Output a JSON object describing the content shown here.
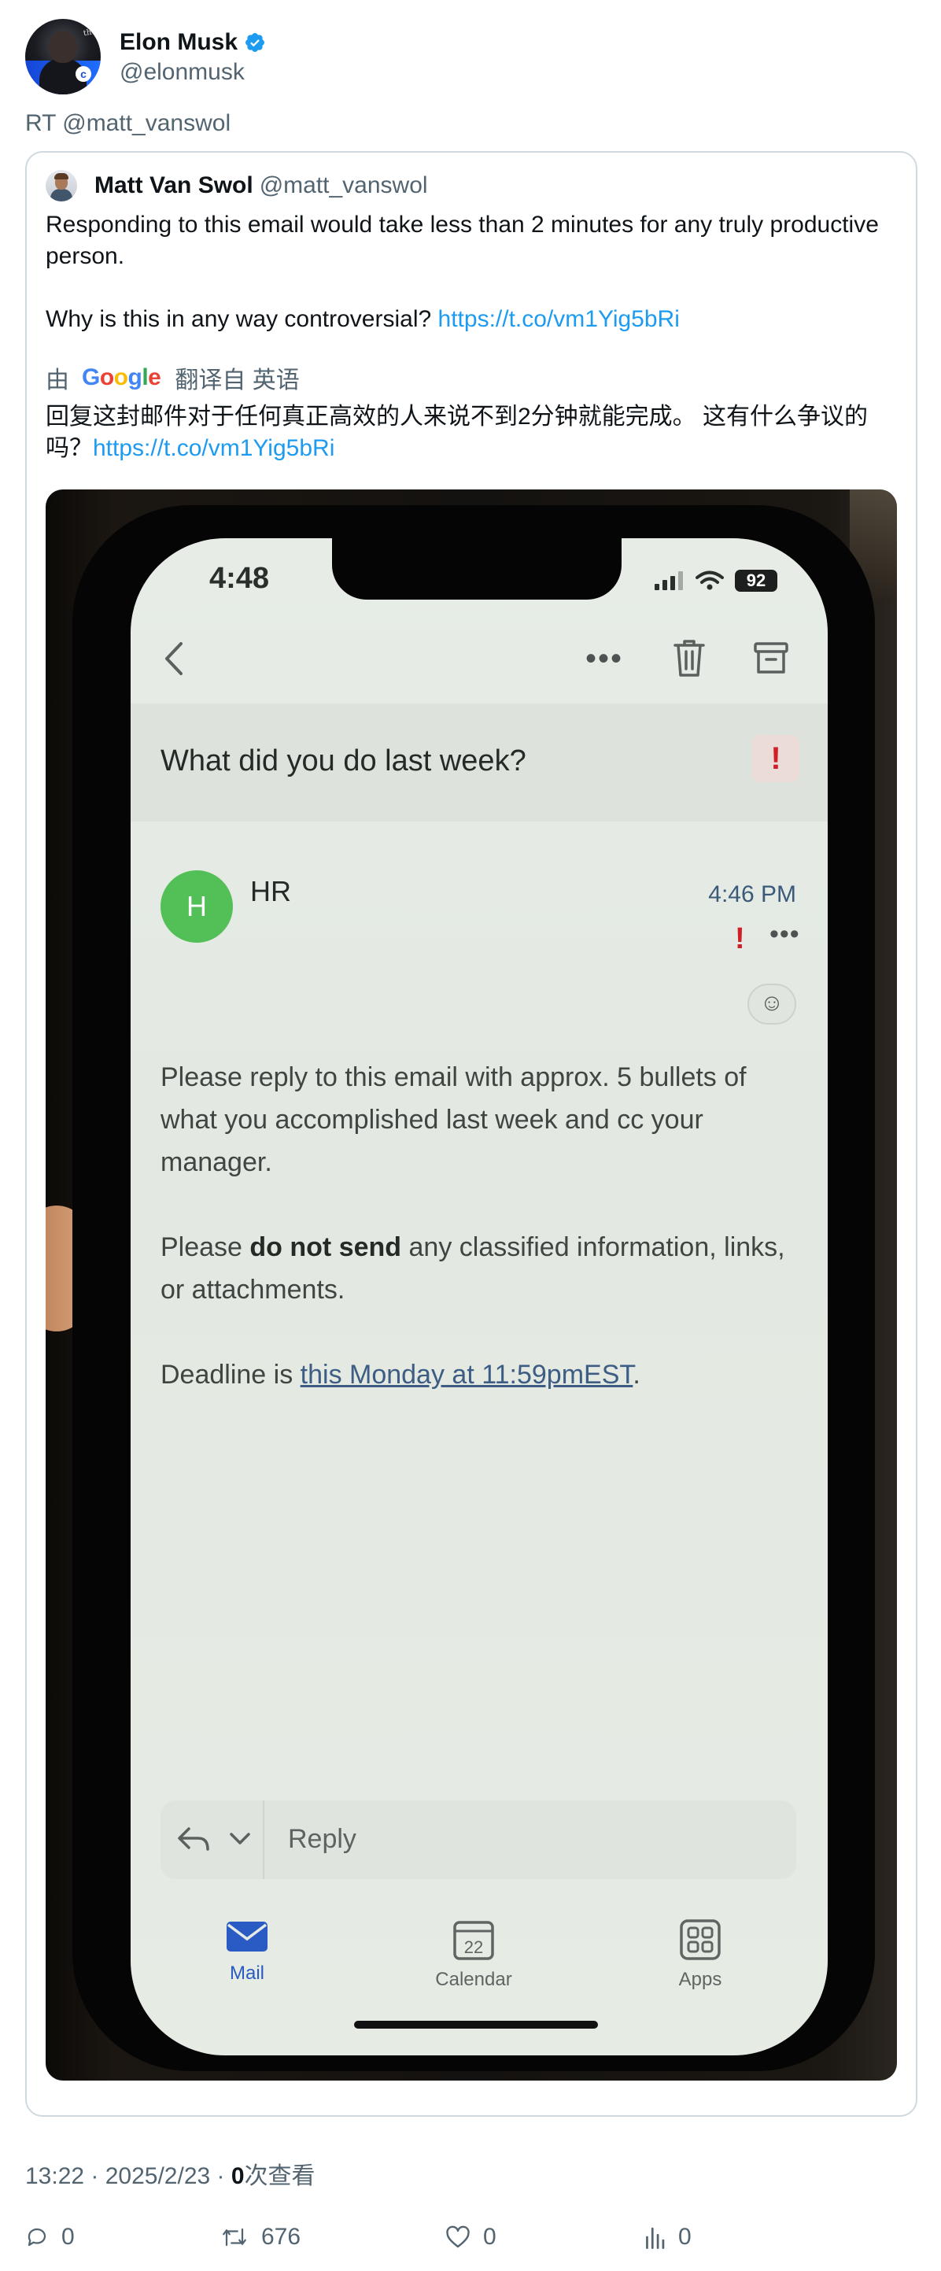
{
  "tweet": {
    "author_name": "Elon Musk",
    "author_handle": "@elonmusk",
    "retweet_label": "RT @matt_vanswol",
    "meta": {
      "time_date": "13:22 · 2025/2/23 · ",
      "views_count": "0",
      "views_label": "次查看"
    },
    "actions": {
      "replies": "0",
      "retweets": "676",
      "likes": "0",
      "views": "0"
    }
  },
  "quote": {
    "author_name": "Matt Van Swol",
    "author_handle": "@matt_vanswol",
    "text_line1": "Responding to this email would take less than 2 minutes for any truly productive person.",
    "text_line2": "Why is this in any way controversial?",
    "link": "https://t.co/vm1Yig5bRi",
    "translate_prefix": "由",
    "translate_brand": "Google",
    "translate_suffix": "翻译自 英语",
    "translated_text": "回复这封邮件对于任何真正高效的人来说不到2分钟就能完成。 这有什么争议的吗？",
    "translated_link": "https://t.co/vm1Yig5bRi"
  },
  "phone": {
    "status_time": "4:48",
    "battery": "92",
    "subject": "What did you do last week?",
    "sender_initial": "H",
    "sender_name": "HR",
    "mail_time": "4:46 PM",
    "body_p1": "Please reply to this email with approx. 5 bullets of what you accomplished last week and cc your manager.",
    "body_p2_pre": "Please ",
    "body_p2_bold": "do not send",
    "body_p2_post": " any classified information, links, or attachments.",
    "body_p3_pre": "Deadline is ",
    "body_p3_link": "this Monday at 11:59pmEST",
    "body_p3_post": ".",
    "reply_placeholder": "Reply",
    "tabs": [
      {
        "label": "Mail",
        "icon": "mail-icon",
        "active": true
      },
      {
        "label": "Calendar",
        "icon": "calendar-icon",
        "day": "22"
      },
      {
        "label": "Apps",
        "icon": "apps-icon"
      }
    ]
  },
  "colors": {
    "link": "#1d9bf0",
    "verified": "#1d9bf0",
    "secondary_text": "#536471",
    "border": "#cfd9de",
    "sender_avatar": "#52bf57",
    "important": "#d02027",
    "tab_active": "#2a5bc4"
  }
}
